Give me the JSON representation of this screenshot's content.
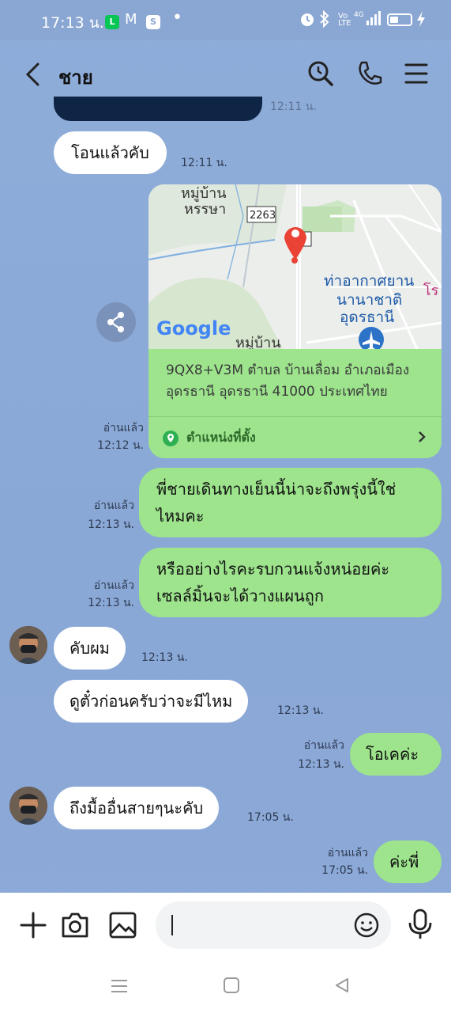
{
  "status_bar": {
    "time": "17:13 น.",
    "network": "4G"
  },
  "header": {
    "title": "ชาย"
  },
  "messages": [
    {
      "id": "m0",
      "dir": "in",
      "time": "12:11 น."
    },
    {
      "id": "m1",
      "dir": "in",
      "text": "โอนแล้วคับ",
      "time": "12:11 น."
    },
    {
      "id": "m2",
      "dir": "out",
      "type": "location",
      "read": "อ่านแล้ว",
      "time": "12:12 น.",
      "map_labels": [
        "หมู่บ้าน",
        "หรรษา",
        "2263",
        "ท่าอากาศยาน",
        "นานาชาติ",
        "อุดรธานี",
        "หมู่บ้าน"
      ],
      "google_logo": "Google",
      "address": "9QX8+V3M ตำบล บ้านเลื่อม อำเภอเมือง อุดรธานี อุดรธานี 41000 ประเทศไทย",
      "location_label": "ตำแหน่งที่ตั้ง"
    },
    {
      "id": "m3",
      "dir": "out",
      "text": "พี่ชายเดินทางเย็นนี้น่าจะถึงพรุ่งนี้ใช่ไหมคะ",
      "read": "อ่านแล้ว",
      "time": "12:13 น."
    },
    {
      "id": "m4",
      "dir": "out",
      "text": "หรืออย่างไรคะรบกวนแจ้งหน่อยค่ะ เซลล์มิ้นจะได้วางแผนถูก",
      "read": "อ่านแล้ว",
      "time": "12:13 น."
    },
    {
      "id": "m5",
      "dir": "in",
      "text": "คับผม",
      "time": "12:13 น."
    },
    {
      "id": "m6",
      "dir": "in",
      "text": "ดูตั๋วก่อนครับว่าจะมีไหม",
      "time": "12:13 น."
    },
    {
      "id": "m7",
      "dir": "out",
      "text": "โอเคค่ะ",
      "read": "อ่านแล้ว",
      "time": "12:13 น."
    },
    {
      "id": "m8",
      "dir": "in",
      "text": "ถึงมื้ออื่นสายๆนะคับ",
      "time": "17:05 น."
    },
    {
      "id": "m9",
      "dir": "out",
      "text": "ค่ะพี่",
      "read": "อ่านแล้ว",
      "time": "17:05 น."
    }
  ],
  "input": {
    "placeholder": "",
    "value": ""
  },
  "colors": {
    "chat_bg": "#8eaad6",
    "out_bubble": "#9de48d",
    "in_bubble": "#ffffff",
    "location_accent": "#2eaf52"
  }
}
